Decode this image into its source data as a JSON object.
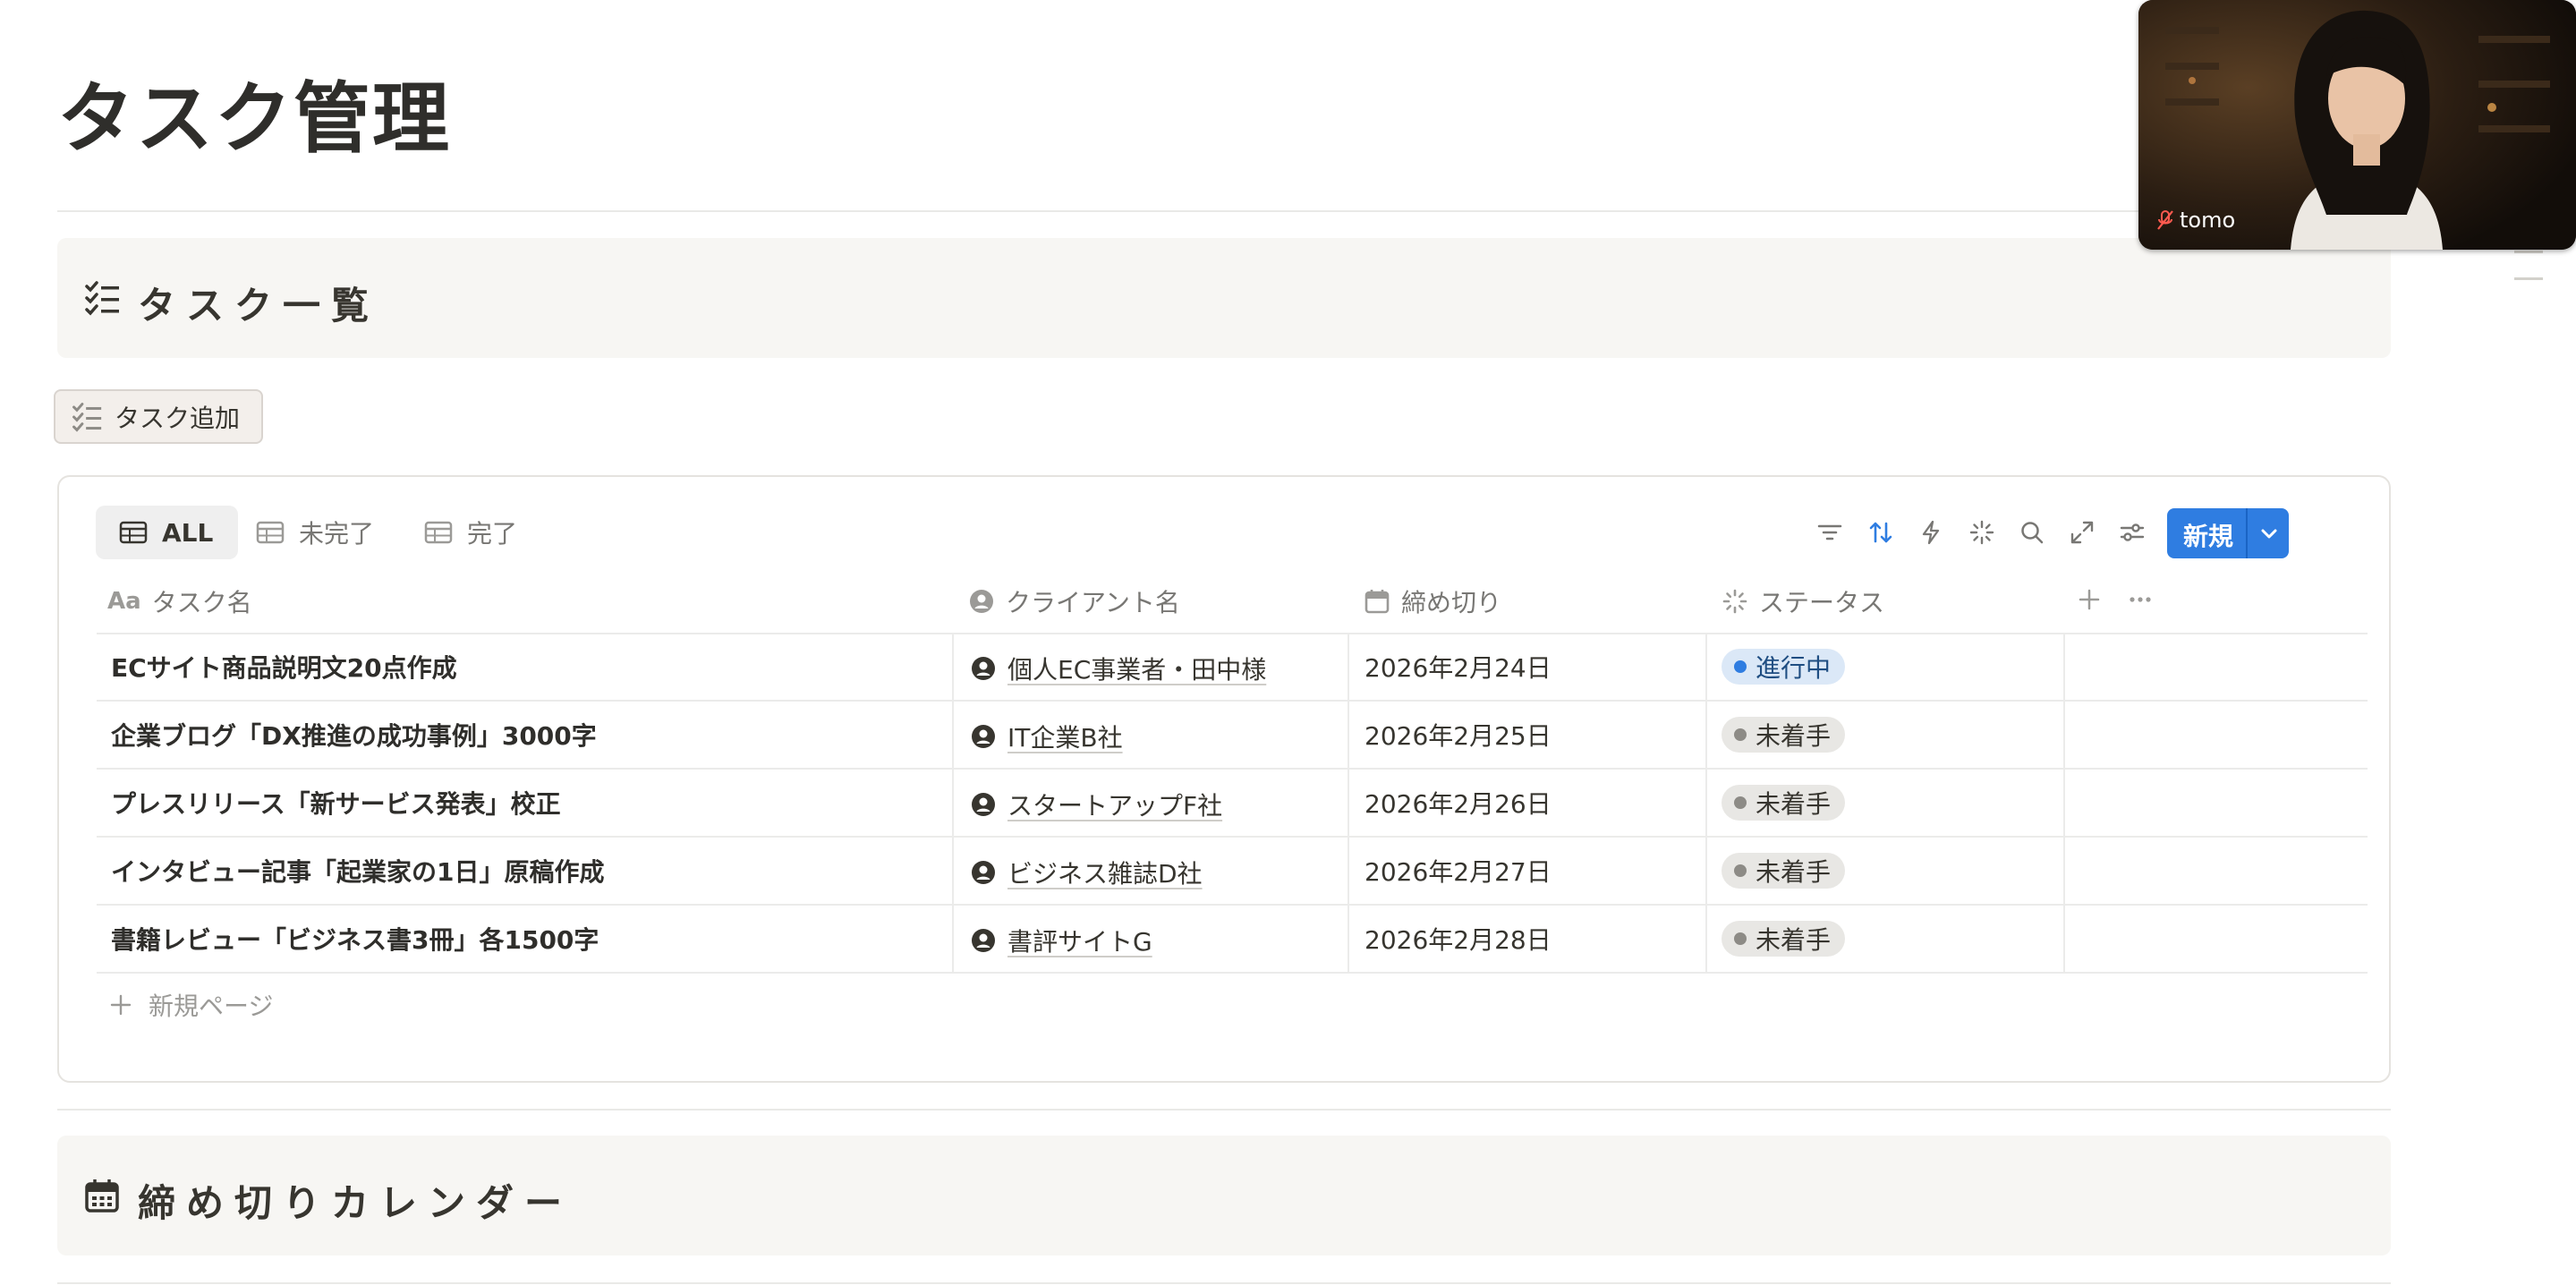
{
  "page": {
    "title": "タスク管理"
  },
  "task_section": {
    "title": "タスク一覧",
    "add_button_label": "タスク追加"
  },
  "database": {
    "tabs": [
      {
        "label": "ALL",
        "active": true
      },
      {
        "label": "未完了",
        "active": false
      },
      {
        "label": "完了",
        "active": false
      }
    ],
    "toolbar": {
      "icons": [
        "filter-icon",
        "sort-icon",
        "automation-icon",
        "ai-sparkle-icon",
        "search-icon",
        "expand-icon",
        "settings-icon"
      ],
      "new_button_label": "新規"
    },
    "columns": [
      {
        "label": "タスク名",
        "icon": "text-aa-icon"
      },
      {
        "label": "クライアント名",
        "icon": "person-icon"
      },
      {
        "label": "締め切り",
        "icon": "calendar-icon"
      },
      {
        "label": "ステータス",
        "icon": "status-spinner-icon"
      }
    ],
    "rows": [
      {
        "task": "ECサイト商品説明文20点作成",
        "client": "個人EC事業者・田中様",
        "deadline": "2026年2月24日",
        "status": "進行中"
      },
      {
        "task": "企業ブログ「DX推進の成功事例」3000字",
        "client": "IT企業B社",
        "deadline": "2026年2月25日",
        "status": "未着手"
      },
      {
        "task": "プレスリリース「新サービス発表」校正",
        "client": "スタートアップF社",
        "deadline": "2026年2月26日",
        "status": "未着手"
      },
      {
        "task": "インタビュー記事「起業家の1日」原稿作成",
        "client": "ビジネス雑誌D社",
        "deadline": "2026年2月27日",
        "status": "未着手"
      },
      {
        "task": "書籍レビュー「ビジネス書3冊」各1500字",
        "client": "書評サイトG",
        "deadline": "2026年2月28日",
        "status": "未着手"
      }
    ],
    "new_page_label": "新規ページ",
    "status_colors": {
      "進行中": "#2f7de1",
      "未着手": "#8d8b86"
    }
  },
  "calendar_section": {
    "title": "締め切りカレンダー"
  },
  "video_call": {
    "participant_name": "tomo"
  },
  "colors": {
    "accent": "#2f7de1",
    "section_bg": "#f7f6f3",
    "text": "#37352f"
  }
}
